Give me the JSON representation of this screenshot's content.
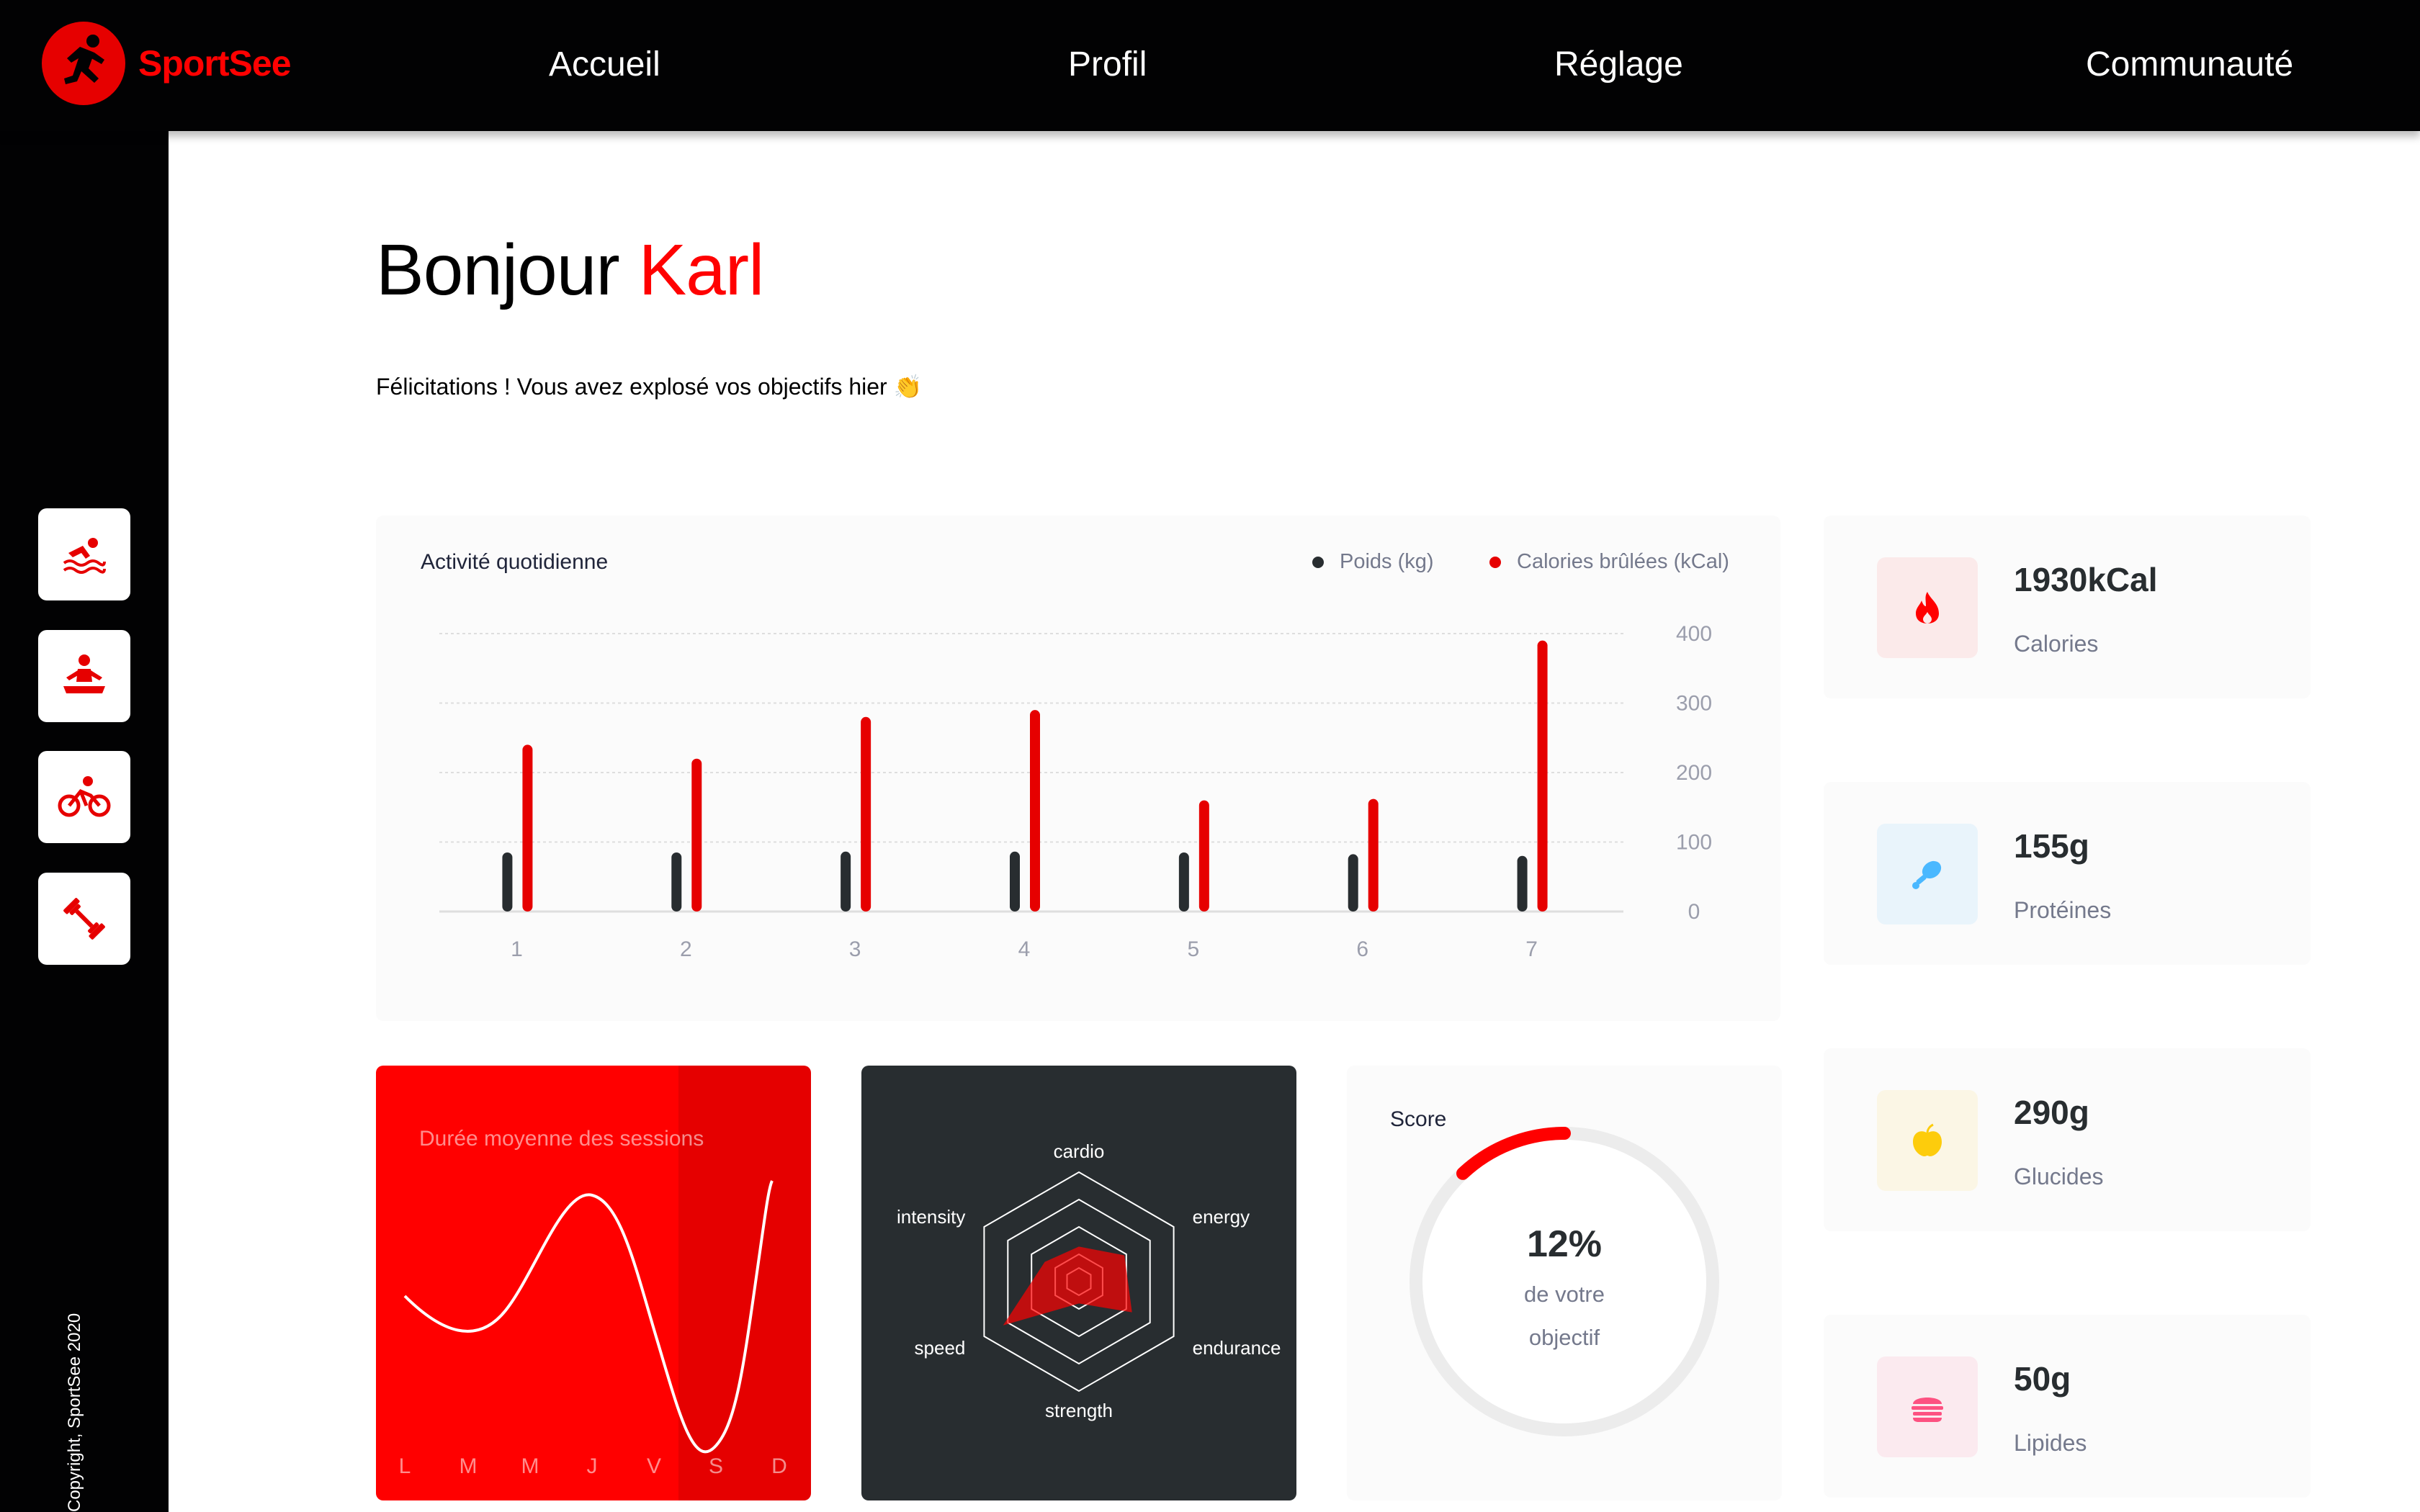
{
  "app": {
    "name": "SportSee"
  },
  "nav": {
    "items": [
      "Accueil",
      "Profil",
      "Réglage",
      "Communauté"
    ]
  },
  "sidebar": {
    "items": [
      {
        "icon": "swimming-icon"
      },
      {
        "icon": "yoga-icon"
      },
      {
        "icon": "cycling-icon"
      },
      {
        "icon": "dumbbell-icon"
      }
    ],
    "copyright": "Copyright, SportSee 2020"
  },
  "greeting": {
    "hello": "Bonjour",
    "name": "Karl",
    "message": "Félicitations ! Vous avez explosé vos objectifs hier 👏"
  },
  "colors": {
    "accent": "#FF0101",
    "dark": "#282D30",
    "nav": "#020203"
  },
  "chart_data": [
    {
      "type": "bar",
      "title": "Activité quotidienne",
      "categories": [
        "1",
        "2",
        "3",
        "4",
        "5",
        "6",
        "7"
      ],
      "series": [
        {
          "name": "Poids (kg)",
          "color": "#282D30",
          "values": [
            80,
            80,
            81,
            81,
            80,
            78,
            76
          ]
        },
        {
          "name": "Calories brûlées (kCal)",
          "color": "#E60000",
          "values": [
            240,
            220,
            280,
            290,
            160,
            162,
            390
          ]
        }
      ],
      "yticks": [
        "0",
        "100",
        "200",
        "300",
        "400"
      ],
      "ylim": [
        0,
        400
      ],
      "legend": "top-right",
      "grid": "dashed horizontal"
    },
    {
      "type": "line",
      "title": "Durée moyenne des sessions",
      "categories": [
        "L",
        "M",
        "M",
        "J",
        "V",
        "S",
        "D"
      ],
      "values": [
        30,
        23,
        45,
        50,
        0,
        0,
        60
      ]
    },
    {
      "type": "radar",
      "categories": [
        "cardio",
        "energy",
        "endurance",
        "strength",
        "speed",
        "intensity"
      ],
      "values": [
        80,
        120,
        140,
        50,
        200,
        90
      ],
      "max": 250
    },
    {
      "type": "pie",
      "title": "Score",
      "value": 12,
      "label_pct": "12%",
      "label_line1": "de votre",
      "label_line2": "objectif"
    }
  ],
  "key_data": [
    {
      "value": "1930kCal",
      "label": "Calories",
      "icon": "flame-icon",
      "bg": "#FBEAEA",
      "fg": "#FF0000"
    },
    {
      "value": "155g",
      "label": "Protéines",
      "icon": "chicken-icon",
      "bg": "#E9F4FB",
      "fg": "#4AB8FF"
    },
    {
      "value": "290g",
      "label": "Glucides",
      "icon": "apple-icon",
      "bg": "#FBF6E5",
      "fg": "#FDCC0C"
    },
    {
      "value": "50g",
      "label": "Lipides",
      "icon": "cheeseburger-icon",
      "bg": "#FBEAEF",
      "fg": "#FD5181"
    }
  ]
}
